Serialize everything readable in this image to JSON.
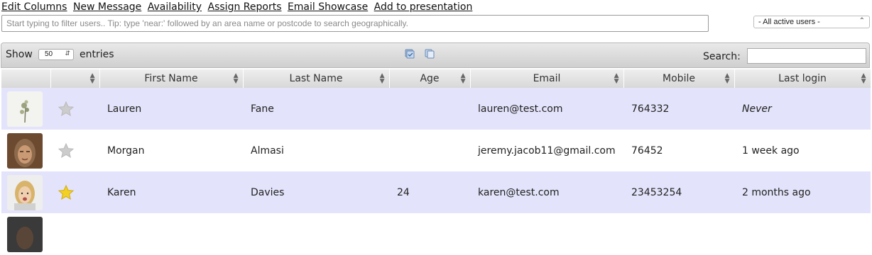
{
  "toplinks": [
    "Edit Columns",
    "New Message",
    "Availability",
    "Assign Reports",
    "Email Showcase",
    "Add to presentation"
  ],
  "filter": {
    "placeholder": "Start typing to filter users.. Tip: type 'near:' followed by an area name or postcode to search geographically."
  },
  "user_filter": {
    "selected": "- All active users -"
  },
  "toolbar": {
    "show_label": "Show",
    "entries_value": "50",
    "entries_label": "entries",
    "search_label": "Search:"
  },
  "columns": [
    "",
    "",
    "First Name",
    "Last Name",
    "Age",
    "Email",
    "Mobile",
    "Last login"
  ],
  "rows": [
    {
      "first": "Lauren",
      "last": "Fane",
      "age": "",
      "email": "lauren@test.com",
      "mobile": "764332",
      "last_login": "Never",
      "starred": false
    },
    {
      "first": "Morgan",
      "last": "Almasi",
      "age": "",
      "email": "jeremy.jacob11@gmail.com",
      "mobile": "76452",
      "last_login": "1 week ago",
      "starred": false
    },
    {
      "first": "Karen",
      "last": "Davies",
      "age": "24",
      "email": "karen@test.com",
      "mobile": "23453254",
      "last_login": "2 months ago",
      "starred": true
    }
  ],
  "colors": {
    "row_highlight": "#e3e3fb",
    "star_active": "#f2d024",
    "star_inactive": "#c8c8c8"
  }
}
